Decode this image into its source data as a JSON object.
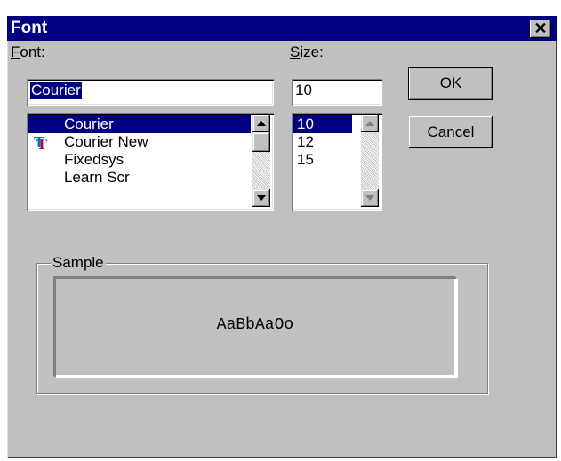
{
  "window": {
    "title": "Font",
    "close_glyph": "✕"
  },
  "font": {
    "label_accel": "F",
    "label_rest": "ont:",
    "input_value": "Courier",
    "items": [
      "Courier",
      "Courier New",
      "Fixedsys",
      "Learn Scr"
    ],
    "selected_index": 0,
    "truetype_item": "Courier New"
  },
  "size": {
    "label_accel": "S",
    "label_rest": "ize:",
    "input_value": "10",
    "items": [
      "10",
      "12",
      "15"
    ],
    "selected_index": 0
  },
  "buttons": {
    "ok": "OK",
    "cancel": "Cancel"
  },
  "sample": {
    "label": "Sample",
    "text": "AaBbAaOo"
  },
  "icons": {
    "truetype": "truetype-icon",
    "close": "close-icon"
  },
  "colors": {
    "selection": "#000080",
    "face": "#c0c0c0",
    "truetype_icon": "#008080"
  }
}
